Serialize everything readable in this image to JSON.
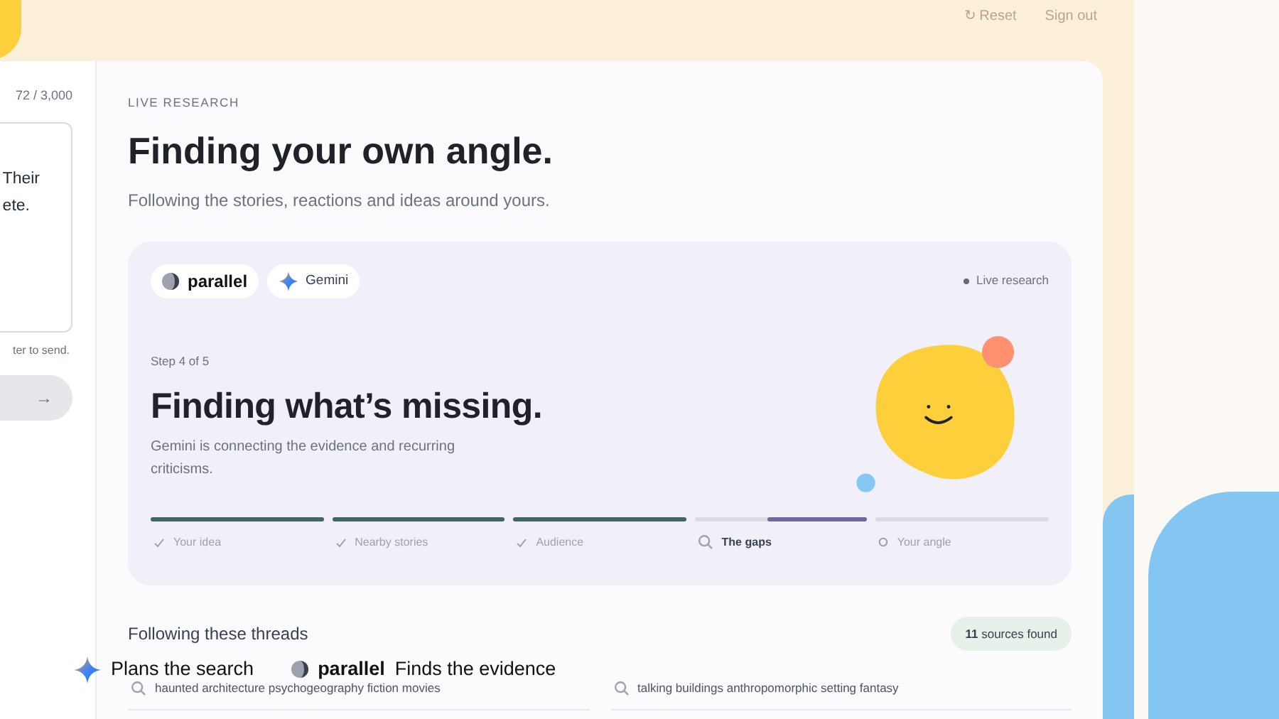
{
  "top_nav": {
    "reset": "↻ Reset",
    "sign_out": "Sign out"
  },
  "composer": {
    "counter": "72 / 3,000",
    "text": "Their\nete.",
    "hint": "ter to send.",
    "send": "→"
  },
  "main": {
    "eyebrow": "LIVE RESEARCH",
    "title": "Finding your own angle.",
    "subtitle": "Following the stories, reactions and ideas around yours.",
    "panel": {
      "logos": [
        {
          "kind": "parallel",
          "label": "parallel"
        },
        {
          "kind": "gemini",
          "label": "Gemini"
        }
      ],
      "status": "Live research",
      "step": "Step 4 of 5",
      "heading": "Finding what’s missing.",
      "description": "Gemini is connecting the evidence and recurring criticisms.",
      "steps": [
        {
          "label": "Your idea",
          "kind": "done",
          "level": 1
        },
        {
          "label": "Nearby stories",
          "kind": "done",
          "level": 1
        },
        {
          "label": "Audience",
          "kind": "done",
          "level": 1
        },
        {
          "label": "The gaps",
          "kind": "active",
          "level": 0.58
        },
        {
          "label": "Your angle",
          "kind": "pending"
        }
      ]
    },
    "threads": {
      "title": "Following these threads",
      "badge": "**11** sources found",
      "queries": [
        "haunted architecture psychogeography fiction movies",
        "talking buildings anthropomorphic setting fantasy"
      ]
    }
  },
  "overlay": {
    "gemini_caption": "Plans the search",
    "parallel_logo": "parallel",
    "parallel_caption": "Finds the evidence"
  }
}
